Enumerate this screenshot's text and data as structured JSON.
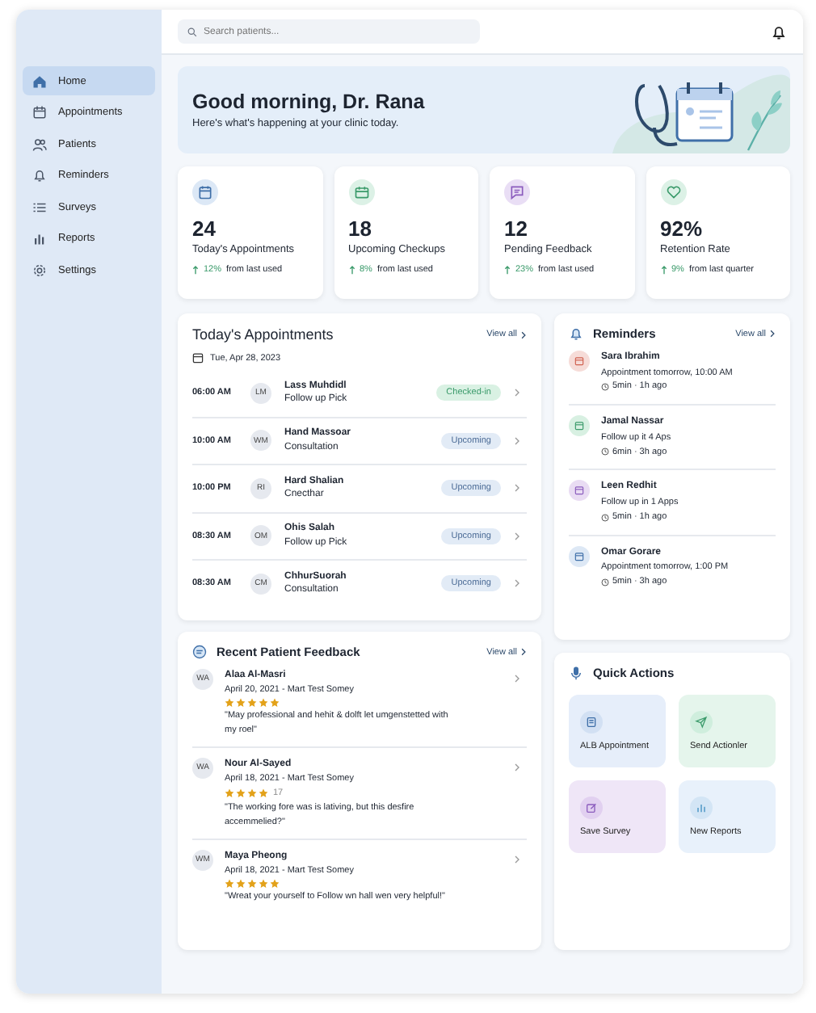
{
  "sidebar": {
    "items": [
      {
        "label": "Home",
        "selected": true
      },
      {
        "label": "Appointments",
        "selected": false
      },
      {
        "label": "Patients",
        "selected": false
      },
      {
        "label": "Reminders",
        "selected": false
      },
      {
        "label": "Surveys",
        "selected": false
      },
      {
        "label": "Reports",
        "selected": false
      },
      {
        "label": "Settings",
        "selected": false
      }
    ]
  },
  "search": {
    "placeholder": "Search patients..."
  },
  "greeting": {
    "title": "Good morning, Dr. Rana",
    "subtitle": "Here's what's happening at your clinic today."
  },
  "stats": [
    {
      "value": "24",
      "label": "Today's Appointments",
      "change": "12%",
      "note": "from last used",
      "color": "#dce8f6"
    },
    {
      "value": "18",
      "label": "Upcoming Checkups",
      "change": "8%",
      "note": "from last used",
      "color": "#dcf1e6"
    },
    {
      "value": "12",
      "label": "Pending Feedback",
      "change": "23%",
      "note": "from last used",
      "color": "#e9def5"
    },
    {
      "value": "92%",
      "label": "Retention Rate",
      "change": "9%",
      "note": "from last quarter",
      "color": "#dcf1e6"
    }
  ],
  "appointments": {
    "title": "Today's Appointments",
    "view_all": "View all",
    "date": "Tue, Apr 28, 2023",
    "rows": [
      {
        "time": "06:00 AM",
        "initials": "LM",
        "name": "Lass Muhdidl",
        "type": "Follow up Pick",
        "status": "Checked-in",
        "kind": "checked-in"
      },
      {
        "time": "10:00 AM",
        "initials": "WM",
        "name": "Hand Massoar",
        "type": "Consultation",
        "status": "Upcoming",
        "kind": "upcoming"
      },
      {
        "time": "10:00 PM",
        "initials": "RI",
        "name": "Hard Shalian",
        "type": "Cnecthar",
        "status": "Upcoming",
        "kind": "upcoming"
      },
      {
        "time": "08:30 AM",
        "initials": "OM",
        "name": "Ohis Salah",
        "type": "Follow up Pick",
        "status": "Upcoming",
        "kind": "upcoming"
      },
      {
        "time": "08:30 AM",
        "initials": "CM",
        "name": "ChhurSuorah",
        "type": "Consultation",
        "status": "Upcoming",
        "kind": "upcoming"
      }
    ]
  },
  "reminders": {
    "title": "Reminders",
    "view_all": "View all",
    "items": [
      {
        "name": "Sara Ibrahim",
        "text": "Appointment tomorrow, 10:00 AM",
        "meta": "5min · 1h ago",
        "color": "#f6dcd8"
      },
      {
        "name": "Jamal Nassar",
        "text": "Follow up it 4 Aps",
        "meta": "6min · 3h ago",
        "color": "#d8f0e2"
      },
      {
        "name": "Leen Redhit",
        "text": "Follow up in 1 Apps",
        "meta": "5min · 1h ago",
        "color": "#e9dcf3"
      },
      {
        "name": "Omar Gorare",
        "text": "Appointment tomorrow, 1:00 PM",
        "meta": "5min · 3h ago",
        "color": "#dde8f5"
      }
    ]
  },
  "feedback": {
    "title": "Recent Patient Feedback",
    "view_all": "View all",
    "items": [
      {
        "initials": "WA",
        "name": "Alaa Al-Masri",
        "source": "April 20, 2021 - Mart Test Somey",
        "stars": 5,
        "quote": "\"May professional and hehit & dolft let umgenstetted with my roel\""
      },
      {
        "initials": "WA",
        "name": "Nour Al-Sayed",
        "source": "April 18, 2021 - Mart Test Somey",
        "stars": 4,
        "count": "17",
        "quote": "\"The working fore was is lativing, but this desfire accemmelied?\""
      },
      {
        "initials": "WM",
        "name": "Maya Pheong",
        "source": "April 18, 2021 - Mart Test Somey",
        "stars": 5,
        "quote": "\"Wreat your yourself to Follow wn hall wen very helpful!\""
      }
    ]
  },
  "quick_actions": {
    "title": "Quick Actions",
    "items": [
      {
        "label": "ALB Appointment",
        "color": "#e6eefa"
      },
      {
        "label": "Send Actionler",
        "color": "#e5f5ec"
      },
      {
        "label": "Save Survey",
        "color": "#efe6f7"
      },
      {
        "label": "New Reports",
        "color": "#e8f1fb"
      }
    ]
  }
}
